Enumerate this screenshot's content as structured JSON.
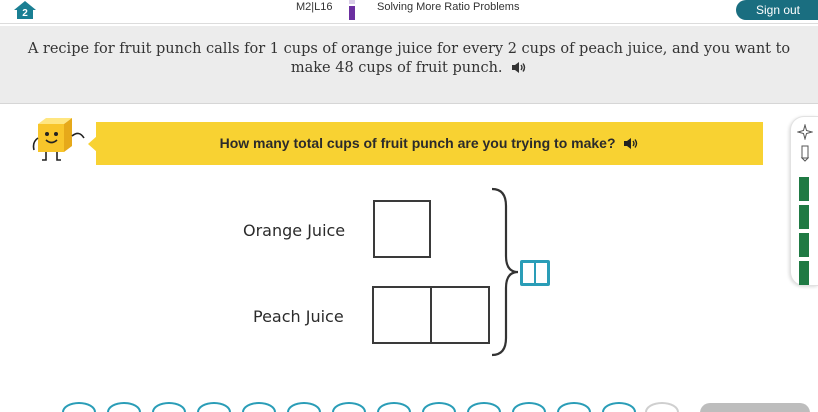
{
  "header": {
    "lesson_code": "M2|L16",
    "lesson_title": "Solving More Ratio Problems",
    "signout_label": "Sign out",
    "home_badge": "2"
  },
  "problem": {
    "text": "A recipe for fruit punch calls for 1 cups of orange juice for every 2 cups of peach juice, and you want to make 48 cups of fruit punch."
  },
  "question": {
    "text": "How many total cups of fruit punch are you trying to make?"
  },
  "diagram": {
    "rows": [
      {
        "label": "Orange Juice",
        "boxes": 1
      },
      {
        "label": "Peach Juice",
        "boxes": 2
      }
    ]
  },
  "sidebar": {
    "progress_bars": 4
  },
  "colors": {
    "accent": "#2a9db7",
    "banner": "#f8d232",
    "signout": "#1a6e80",
    "progress": "#1f7a44"
  }
}
